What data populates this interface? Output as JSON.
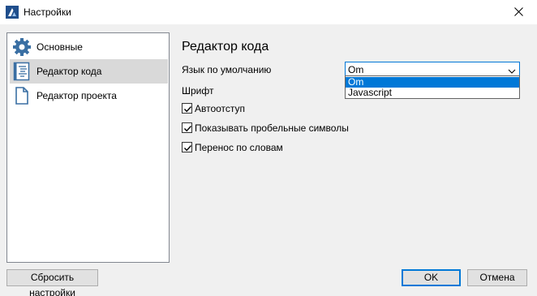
{
  "window": {
    "title": "Настройки",
    "icons": {
      "app": "app-logo-icon",
      "close": "close-icon"
    }
  },
  "sidebar": {
    "items": [
      {
        "label": "Основные",
        "icon": "gear-icon",
        "selected": false
      },
      {
        "label": "Редактор кода",
        "icon": "code-document-icon",
        "selected": true
      },
      {
        "label": "Редактор проекта",
        "icon": "document-icon",
        "selected": false
      }
    ]
  },
  "main": {
    "section_title": "Редактор кода",
    "default_language_label": "Язык по умолчанию",
    "default_language_value": "Om",
    "language_options": [
      "Om",
      "Javascript"
    ],
    "font_label": "Шрифт",
    "checkboxes": [
      {
        "label": "Автоотступ",
        "checked": true
      },
      {
        "label": "Показывать пробельные символы",
        "checked": true
      },
      {
        "label": "Перенос по словам",
        "checked": true
      }
    ]
  },
  "buttons": {
    "reset": "Сбросить настройки",
    "ok": "OK",
    "cancel": "Отмена"
  },
  "colors": {
    "accent": "#0078d7",
    "selection": "#d9d9d9",
    "icon_blue": "#3a6fa3"
  }
}
